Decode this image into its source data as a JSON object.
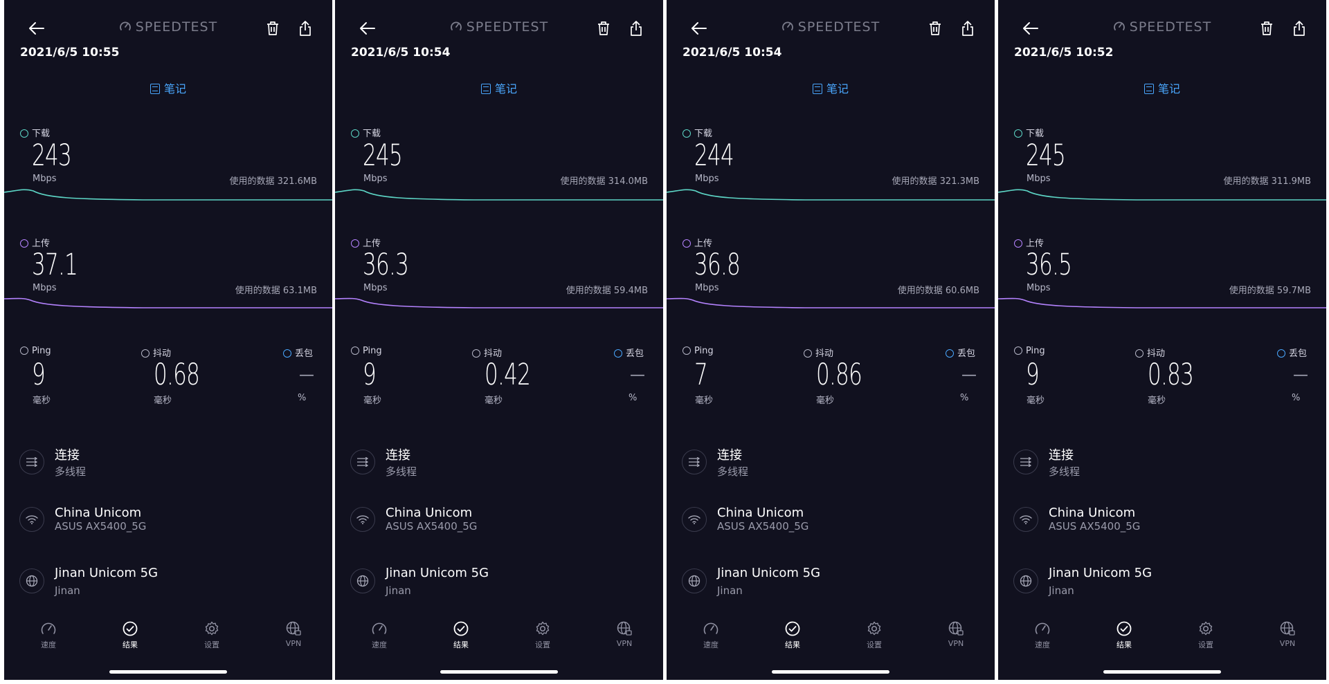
{
  "app": {
    "brand": "SPEEDTEST",
    "notes_label": "笔记",
    "download_label": "下载",
    "upload_label": "上传",
    "unit_mbps": "Mbps",
    "ping_label": "Ping",
    "jitter_label": "抖动",
    "loss_label": "丢包",
    "unit_ms": "毫秒",
    "unit_pct": "%",
    "connections_title": "连接",
    "connections_value": "多线程",
    "isp": "China Unicom",
    "router": "ASUS AX5400_5G",
    "server": "Jinan Unicom 5G",
    "server_city": "Jinan",
    "nav": [
      "速度",
      "结果",
      "设置",
      "VPN"
    ],
    "colors": {
      "download": "#5dd6c6",
      "upload": "#b583ff",
      "accent": "#4aa8ff",
      "background": "#11111f"
    }
  },
  "results": [
    {
      "datetime": "2021/6/5 10:55",
      "download": "243",
      "download_data": "使用的数据 321.6MB",
      "upload": "37.1",
      "upload_data": "使用的数据 63.1MB",
      "ping": "9",
      "jitter": "0.68",
      "loss": "—"
    },
    {
      "datetime": "2021/6/5 10:54",
      "download": "245",
      "download_data": "使用的数据 314.0MB",
      "upload": "36.3",
      "upload_data": "使用的数据 59.4MB",
      "ping": "9",
      "jitter": "0.42",
      "loss": "—"
    },
    {
      "datetime": "2021/6/5 10:54",
      "download": "244",
      "download_data": "使用的数据 321.3MB",
      "upload": "36.8",
      "upload_data": "使用的数据 60.6MB",
      "ping": "7",
      "jitter": "0.86",
      "loss": "—"
    },
    {
      "datetime": "2021/6/5 10:52",
      "download": "245",
      "download_data": "使用的数据 311.9MB",
      "upload": "36.5",
      "upload_data": "使用的数据 59.7MB",
      "ping": "9",
      "jitter": "0.83",
      "loss": "—"
    }
  ]
}
